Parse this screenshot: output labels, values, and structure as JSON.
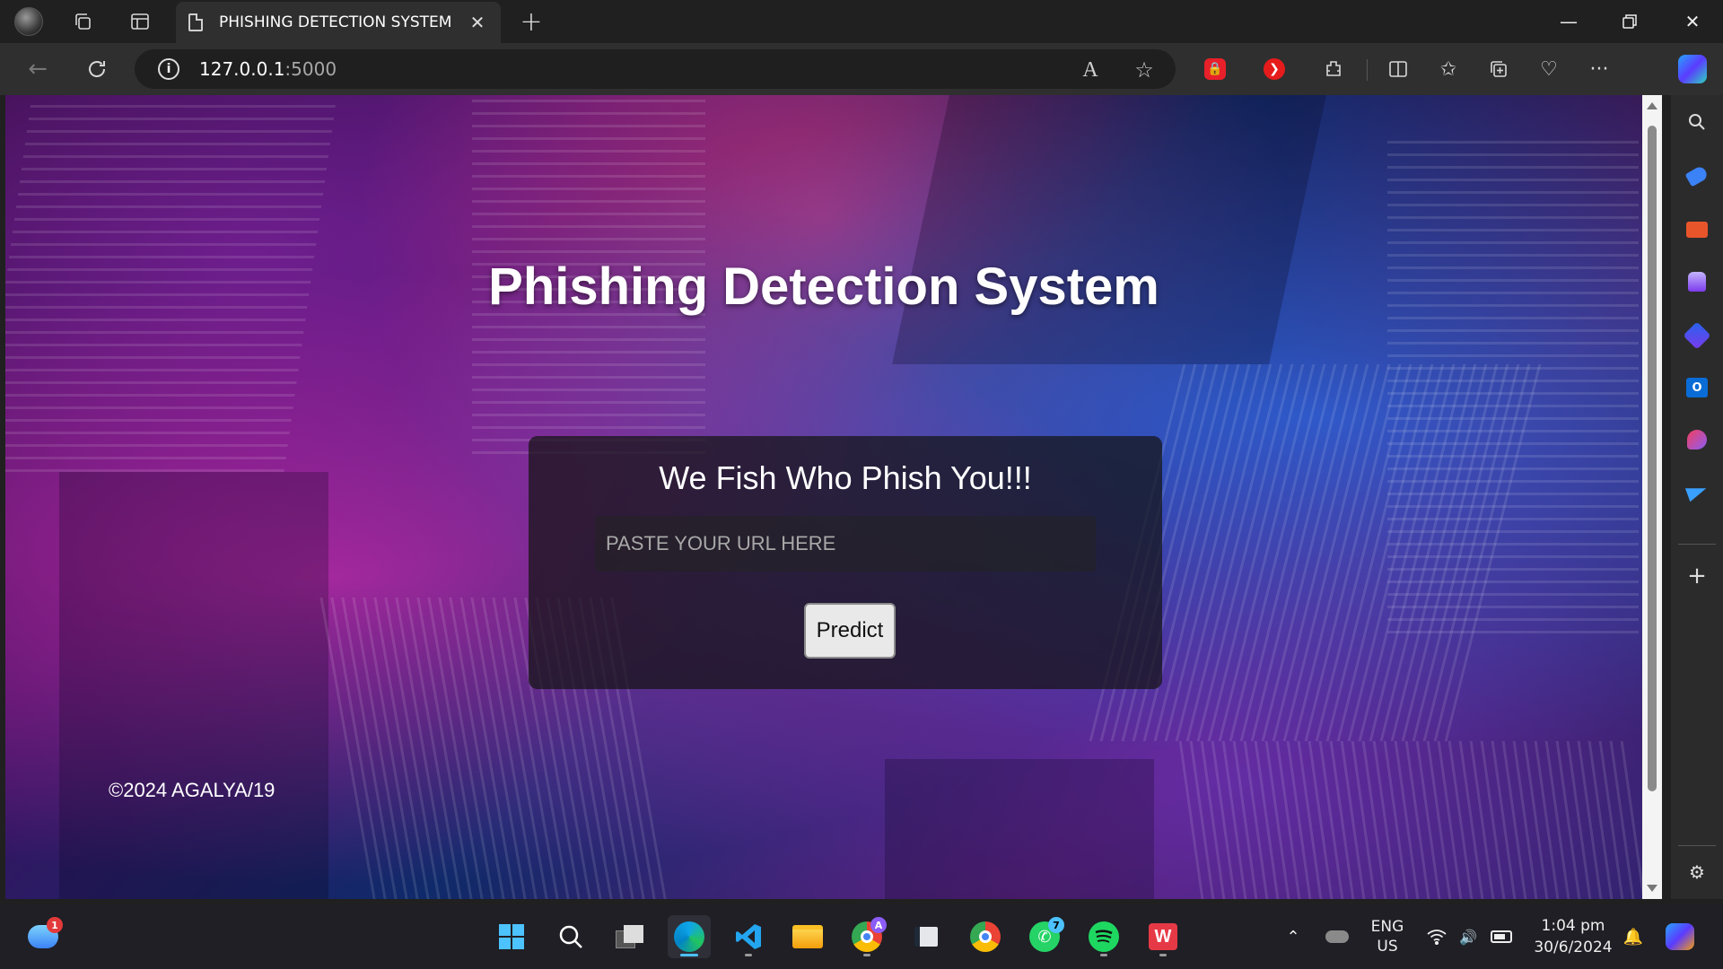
{
  "browser": {
    "tab_title": "PHISHING DETECTION SYSTEM",
    "address_host": "127.0.0.1",
    "address_port": ":5000",
    "read_aloud_glyph": "A",
    "more_glyph": "···"
  },
  "page": {
    "heading": "Phishing Detection System",
    "card_title": "We Fish Who Phish You!!!",
    "url_placeholder": "PASTE YOUR URL HERE",
    "url_value": "",
    "predict_label": "Predict",
    "footer": "©2024 AGALYA/19"
  },
  "taskbar": {
    "weather_badge": "1",
    "chrome_badge": "A",
    "whatsapp_badge": "7",
    "lang_line1": "ENG",
    "lang_line2": "US",
    "time": "1:04 pm",
    "date": "30/6/2024"
  },
  "colors": {
    "accent_blue": "#4cc2ff",
    "toolbar_bg": "#2f2f2f",
    "titlebar_bg": "#202020",
    "card_bg": "rgba(20,20,20,0.72)"
  },
  "icons": {
    "sidebar": [
      "search-icon",
      "tag-icon",
      "toolbox-icon",
      "games-icon",
      "copilot-icon",
      "outlook-icon",
      "designer-icon",
      "send-icon",
      "add-icon",
      "settings-icon"
    ],
    "taskbar": [
      "weather-icon",
      "windows-start-icon",
      "search-icon",
      "task-view-icon",
      "edge-icon",
      "vscode-icon",
      "file-explorer-icon",
      "chrome-icon",
      "files-icon",
      "chrome-icon",
      "whatsapp-icon",
      "spotify-icon",
      "wps-icon"
    ]
  }
}
